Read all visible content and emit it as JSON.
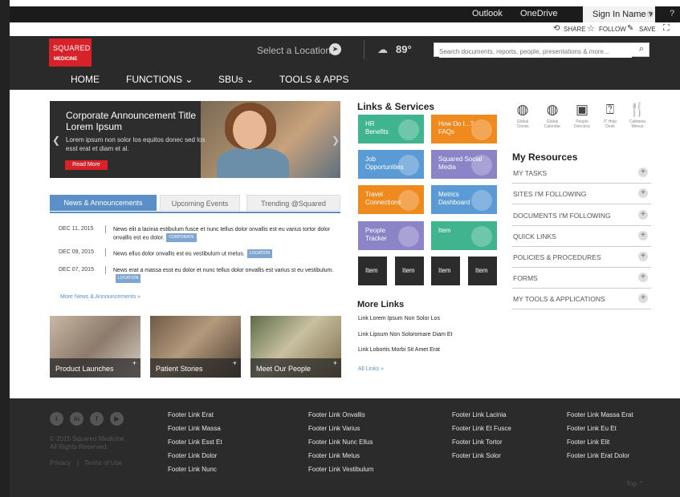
{
  "topbar": {
    "outlook": "Outlook",
    "onedrive": "OneDrive",
    "signin": "Sign In Name ▾",
    "help": "?"
  },
  "sharebar": {
    "share": "SHARE",
    "follow": "FOLLOW",
    "save": "SAVE"
  },
  "brand": {
    "line1": "SQUARED",
    "line2": "MEDICINE",
    "color": "#d8222a"
  },
  "header": {
    "select_location": "Select a Location",
    "temperature": "89°",
    "search_placeholder": "Search documents, reports, people, presentations & more..."
  },
  "nav": [
    "HOME",
    "FUNCTIONS ⌄",
    "SBUs ⌄",
    "TOOLS & APPS"
  ],
  "hero": {
    "title": "Corporate Announcement Title Lorem Ipsum",
    "body": "Lorem ipsum non solor los equitos donec sed los esst erat et diam et al.",
    "button": "Read More"
  },
  "tabs": [
    "News & Announcements",
    "Upcoming Events",
    "Trending @Squared"
  ],
  "news": [
    {
      "date": "DEC 11, 2015",
      "text": "News elit a lacinia estibulum fusce et nunc tellus dolor onvallis est eu varius tortor dolor onvallis est eu dolor.",
      "badge": "CORPORATE"
    },
    {
      "date": "DEC 09, 2015",
      "text": "News ellus dolor onvallis est eu vestibulum ut metus.",
      "badge": "LOCATION"
    },
    {
      "date": "DEC 07, 2015",
      "text": "News erat a massa esst eu dolor et nunc tellus dolor onvallis est varius st eu vestibulum.",
      "badge": "LOCATION"
    }
  ],
  "more_news": "More News & Announcements »",
  "cards": [
    "Product Launches",
    "Patient Stories",
    "Meet Our People"
  ],
  "links_services": {
    "title": "Links & Services",
    "tiles": [
      {
        "label": "HR Benefits",
        "color": "#3fb48f"
      },
      {
        "label": "How Do I...? FAQs",
        "color": "#ef8a1e"
      },
      {
        "label": "Job Opportunities",
        "color": "#5b9bd5"
      },
      {
        "label": "Squared Social Media",
        "color": "#8b84c6"
      },
      {
        "label": "Travel Connections",
        "color": "#ef8a1e"
      },
      {
        "label": "Metrics Dashboard",
        "color": "#5b9bd5"
      },
      {
        "label": "People Tracker",
        "color": "#8b84c6"
      },
      {
        "label": "Item",
        "color": "#3fb48f"
      },
      {
        "label": "Item",
        "color": "#2c2c2c"
      },
      {
        "label": "Item",
        "color": "#2c2c2c"
      },
      {
        "label": "Item",
        "color": "#2c2c2c"
      },
      {
        "label": "Item",
        "color": "#2c2c2c"
      }
    ]
  },
  "more_links": {
    "title": "More Links",
    "items": [
      "Link Lorem Ipsum Non Solor Los",
      "Link Lipsum Non Solorornare Diam Et",
      "Link Lobortis Morbi Sit Amet Erat"
    ],
    "all": "All Links »"
  },
  "quick_icons": [
    {
      "label": "Global Clocks",
      "icon": "globe-clock-icon"
    },
    {
      "label": "Global Calendar",
      "icon": "globe-calendar-icon"
    },
    {
      "label": "People Directory",
      "icon": "people-directory-icon"
    },
    {
      "label": "IT Help Desk",
      "icon": "help-desk-icon"
    },
    {
      "label": "Cafeteria Menus",
      "icon": "cafeteria-icon"
    }
  ],
  "resources": {
    "title": "My Resources",
    "items": [
      "MY TASKS",
      "SITES I'M FOLLOWING",
      "DOCUMENTS I'M FOLLOWING",
      "QUICK LINKS",
      "POLICIES & PROCEDURES",
      "FORMS",
      "MY TOOLS & APPLICATIONS"
    ]
  },
  "footer": {
    "copyright1": "© 2015 Squared Medicine.",
    "copyright2": "All Rights Reserved.",
    "privacy": "Privacy",
    "divider": "|",
    "terms": "Terms of Use",
    "top": "Top ⌃",
    "col1": [
      "Footer Link Erat",
      "Footer Link Massa",
      "Footer Link Esst Et",
      "Footer Link Dolor",
      "Footer Link Nunc"
    ],
    "col2": [
      "Footer Link Onvallis",
      "Footer Link Varius",
      "Footer Link Nunc Ellus",
      "Footer Link Metus",
      "Footer Link Vestibulum"
    ],
    "col3": [
      "Footer Link Lacinia",
      "Footer Link Et Fusce",
      "Footer Link Tortor",
      "Footer Link Solor"
    ],
    "col4": [
      "Footer Link Massa Erat",
      "Footer Link Eu Et",
      "Footer Link Elit",
      "Footer Link Erat Dolor"
    ]
  }
}
